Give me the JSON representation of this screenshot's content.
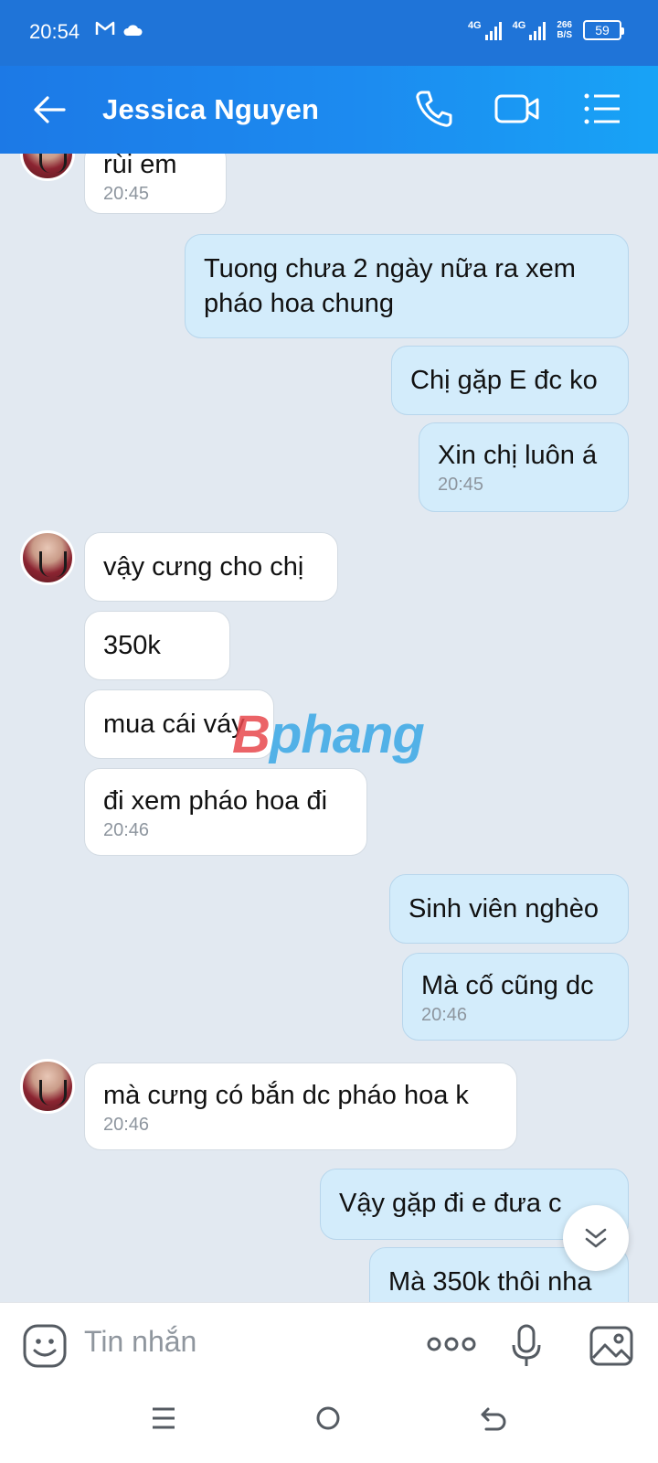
{
  "status_bar": {
    "time": "20:54",
    "net1": "4G",
    "net2": "4G",
    "speed_value": "266",
    "speed_unit": "B/S",
    "battery": "59"
  },
  "header": {
    "contact_name": "Jessica Nguyen"
  },
  "messages": [
    {
      "dir": "in",
      "text": "rùi em",
      "time": "20:45"
    },
    {
      "dir": "out",
      "text_line1": "Tuong chưa 2 ngày nữa ra xem",
      "text_line2": "pháo hoa chung"
    },
    {
      "dir": "out",
      "text": "Chị gặp E đc ko"
    },
    {
      "dir": "out",
      "text": "Xin chị luôn á",
      "time": "20:45"
    },
    {
      "dir": "in",
      "text": "vậy cưng cho chị"
    },
    {
      "dir": "in",
      "text": "350k"
    },
    {
      "dir": "in",
      "text": "mua cái váy"
    },
    {
      "dir": "in",
      "text": "đi xem pháo hoa đi",
      "time": "20:46"
    },
    {
      "dir": "out",
      "text": "Sinh viên nghèo"
    },
    {
      "dir": "out",
      "text": "Mà cố cũng dc",
      "time": "20:46"
    },
    {
      "dir": "in",
      "text": "mà cưng có bắn dc pháo hoa k",
      "time": "20:46"
    },
    {
      "dir": "out",
      "text": "Vậy gặp đi e đưa c"
    },
    {
      "dir": "out",
      "text": "Mà 350k thôi nha"
    }
  ],
  "watermark": {
    "first": "B",
    "rest": "phang"
  },
  "composer": {
    "placeholder": "Tin nhắn"
  },
  "colors": {
    "header_blue": "#1c79e6",
    "outgoing_bubble": "#d3ecfb",
    "incoming_bubble": "#ffffff",
    "chat_background": "#e2e9f1"
  }
}
